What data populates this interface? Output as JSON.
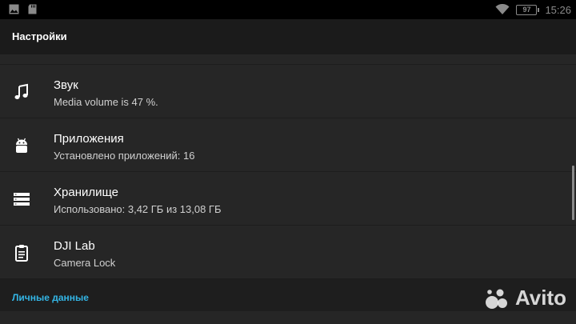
{
  "status_bar": {
    "battery_level": "97",
    "time": "15:26",
    "icons": [
      "image-icon",
      "sd-card-icon",
      "wifi-icon",
      "battery-icon"
    ]
  },
  "action_bar": {
    "title": "Настройки"
  },
  "settings": {
    "items": [
      {
        "icon": "music-note-icon",
        "title": "Звук",
        "summary": "Media volume is 47 %."
      },
      {
        "icon": "android-icon",
        "title": "Приложения",
        "summary": "Установлено приложений: 16"
      },
      {
        "icon": "storage-icon",
        "title": "Хранилище",
        "summary": "Использовано: 3,42 ГБ из 13,08 ГБ"
      },
      {
        "icon": "clipboard-icon",
        "title": "DJI Lab",
        "summary": "Camera Lock"
      }
    ],
    "category": "Личные данные"
  },
  "watermark": {
    "text": "Avito"
  },
  "colors": {
    "background": "#262626",
    "action_bar": "#1b1b1b",
    "accent": "#33b5e5",
    "status_bar": "#000000"
  }
}
